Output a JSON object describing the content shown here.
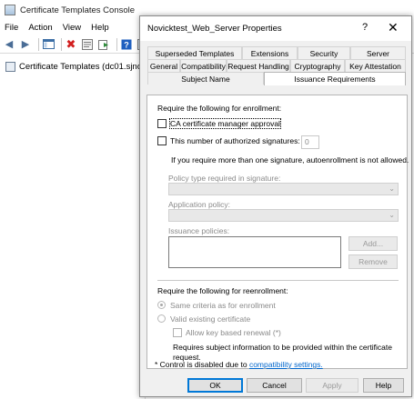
{
  "console": {
    "title": "Certificate Templates Console",
    "menu": [
      "File",
      "Action",
      "View",
      "Help"
    ],
    "tree_item": "Certificate Templates (dc01.sjno"
  },
  "dialog": {
    "title": "Novicktest_Web_Server Properties",
    "help_glyph": "?",
    "close_glyph": "✕",
    "tabs_row1": [
      "Superseded Templates",
      "Extensions",
      "Security",
      "Server"
    ],
    "tabs_row2": [
      "General",
      "Compatibility",
      "Request Handling",
      "Cryptography",
      "Key Attestation"
    ],
    "tabs_row3": [
      "Subject Name",
      "Issuance Requirements"
    ],
    "active_tab": "Issuance Requirements",
    "enrollment_heading": "Require the following for enrollment:",
    "ca_approval_label": "CA certificate manager approval",
    "ca_approval_checked": false,
    "signatures_label": "This number of authorized signatures:",
    "signatures_checked": false,
    "signatures_value": "0",
    "signature_note": "If you require more than one signature, autoenrollment is not allowed.",
    "policy_type_label": "Policy type required in signature:",
    "policy_type_value": "",
    "application_policy_label": "Application policy:",
    "application_policy_value": "",
    "issuance_policies_label": "Issuance policies:",
    "add_button": "Add...",
    "remove_button": "Remove",
    "reenrollment_heading": "Require the following for reenrollment:",
    "same_criteria_label": "Same criteria as for enrollment",
    "same_criteria_selected": true,
    "valid_cert_label": "Valid existing certificate",
    "key_renewal_label": "Allow key based renewal (*)",
    "requires_subject_line1": "Requires subject information to be provided within the certificate",
    "requires_subject_line2": "request.",
    "disabled_note_prefix": "* Control is disabled due to ",
    "disabled_note_link": "compatibility settings.",
    "ok_button": "OK",
    "cancel_button": "Cancel",
    "apply_button": "Apply",
    "help_button": "Help"
  }
}
